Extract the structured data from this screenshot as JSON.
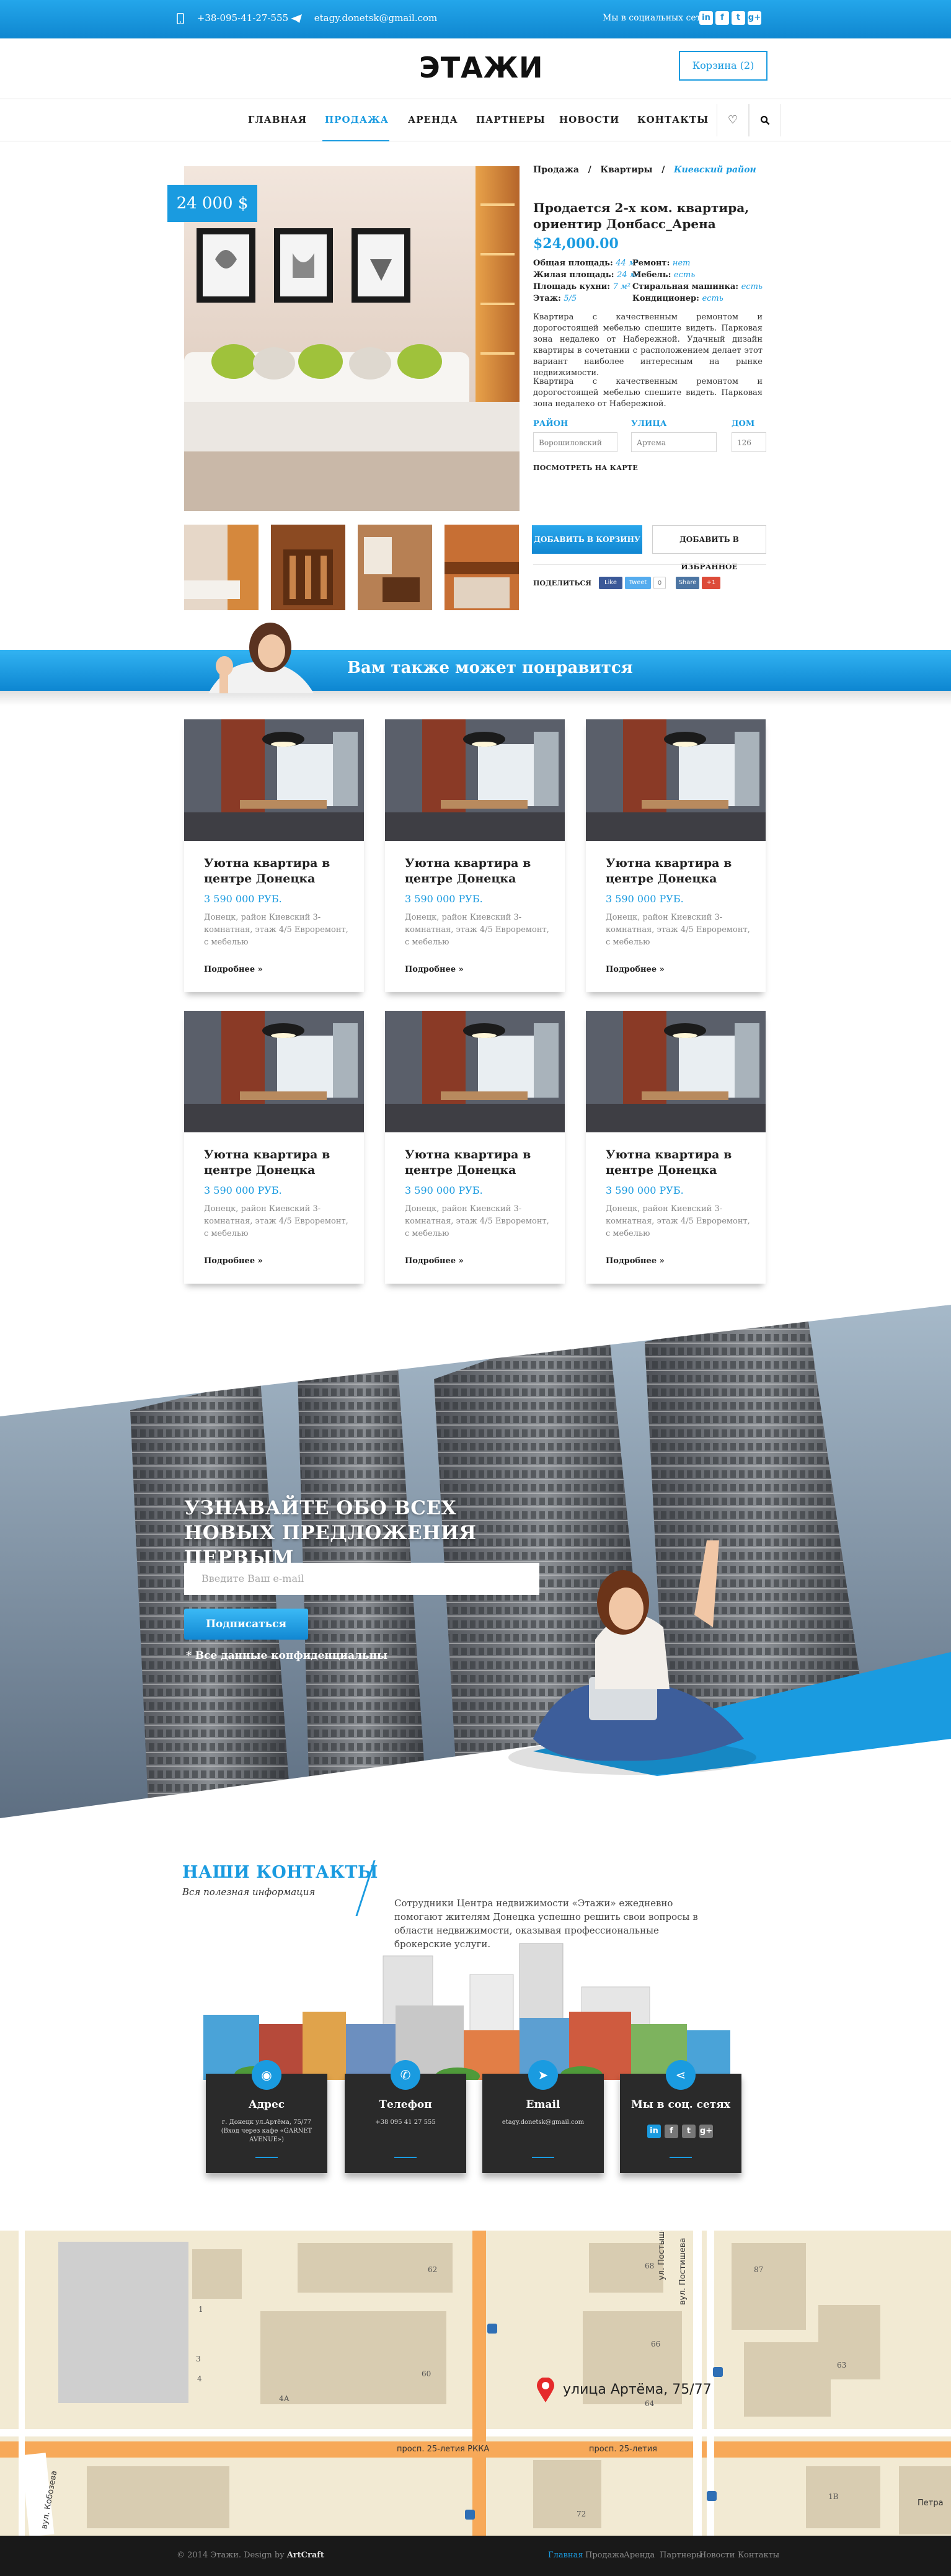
{
  "topbar": {
    "phone": "+38-095-41-27-555",
    "email": "etagy.donetsk@gmail.com",
    "social_text": "Мы в социальных сетях",
    "social": [
      "in",
      "f",
      "t",
      "g+"
    ]
  },
  "header": {
    "logo": "ЭТАЖИ",
    "cart_label": "Корзина",
    "cart_count": "(2)"
  },
  "nav": {
    "items": [
      "ГЛАВНАЯ",
      "ПРОДАЖА",
      "АРЕНДА",
      "ПАРТНЕРЫ",
      "НОВОСТИ",
      "КОНТАКТЫ"
    ],
    "active": "ПРОДАЖА"
  },
  "product": {
    "price_tag": "24 000 $",
    "breadcrumb": [
      "Продажа",
      "/",
      "Квартиры",
      "/",
      "Киевский район"
    ],
    "title": "Продается 2-х ком. квартира, ориентир Донбасс_Арена",
    "price": "$24,000.00",
    "specs_left": [
      {
        "label": "Общая площадь",
        "value": "44 м²"
      },
      {
        "label": "Жилая площадь",
        "value": "24 м²"
      },
      {
        "label": "Площадь кухни",
        "value": "7 м²"
      },
      {
        "label": "Этаж",
        "value": "5/5"
      }
    ],
    "specs_right": [
      {
        "label": "Ремонт",
        "value": "нет"
      },
      {
        "label": "Мебель",
        "value": "есть"
      },
      {
        "label": "Стиральная машинка",
        "value": "есть"
      },
      {
        "label": "Кондиционер",
        "value": "есть"
      }
    ],
    "desc1": "Квартира с качественным ремонтом и дорогостоящей мебелью спешите видеть. Парковая зона недалеко от Набережной. Удачный дизайн квартиры в сочетании с расположением делает этот вариант наиболее интересным на рынке недвижимости.",
    "desc2": "Квартира с качественным ремонтом и дорогостоящей мебелью спешите видеть. Парковая зона недалеко от Набережной.",
    "field_labels": [
      "РАЙОН",
      "УЛИЦА",
      "ДОМ"
    ],
    "field_values": [
      "Ворошиловский",
      "Артема",
      "126"
    ],
    "map_link": "ПОСМОТРЕТЬ НА КАРТЕ",
    "add_cart": "ДОБАВИТЬ В КОРЗИНУ",
    "add_fav": "ДОБАВИТЬ В ИЗБРАННОЕ",
    "share_label": "ПОДЕЛИТЬСЯ",
    "share_buttons": [
      "Like",
      "Tweet",
      "Share",
      "+1"
    ]
  },
  "recommend": {
    "title": "Вам также может понравится",
    "card": {
      "title": "Уютна квартира в центре Донецка",
      "price": "3 590 000 РУБ.",
      "desc": "Донецк, район Киевский 3-комнатная, этаж 4/5 Евроремонт, с мебелью",
      "more": "Подробнее »"
    }
  },
  "subscribe": {
    "title": "УЗНАВАЙТЕ ОБО ВСЕХ НОВЫХ ПРЕДЛОЖЕНИЯ ПЕРВЫМ",
    "placeholder": "Введите Ваш e-mail",
    "button": "Подписаться",
    "note": "* Все данные конфиденциальны"
  },
  "contacts": {
    "title": "НАШИ КОНТАКТЫ",
    "subtitle": "Вся полезная информация",
    "text": "Сотрудники Центра недвижимости «Этажи» ежедневно помогают жителям Донецка успешно решить свои вопросы в области недвижимости, оказывая профессиональные брокерские услуги.",
    "boxes": [
      {
        "title": "Адрес",
        "value": "г. Донецк ул.Артёма, 75/77 (Вход через кафе «GARNET AVENUE»)"
      },
      {
        "title": "Телефон",
        "value": "+38 095 41 27 555"
      },
      {
        "title": "Email",
        "value": "etagy.donetsk@gmail.com"
      },
      {
        "title": "Мы в соц. сетях",
        "value": ""
      }
    ]
  },
  "map": {
    "marker_label": "улица Артёма, 75/77",
    "streets": [
      "просп. 25-летия РККА",
      "просп. 25-летия",
      "ул. Постышева",
      "вул. Постишева",
      "вул. Кобозева",
      "Петра"
    ],
    "numbers": [
      "62",
      "68",
      "87",
      "1",
      "66",
      "63",
      "3",
      "4",
      "60",
      "4А",
      "64",
      "72",
      "1В"
    ]
  },
  "footer": {
    "copyright": "© 2014 Этажи. Design by",
    "author": "ArtCraft",
    "links": [
      "Главная",
      "Продажа",
      "Аренда",
      "Партнеры",
      "Новости",
      "Контакты"
    ]
  },
  "colors": {
    "accent": "#1a9be0",
    "dark": "#2a2a2a"
  }
}
